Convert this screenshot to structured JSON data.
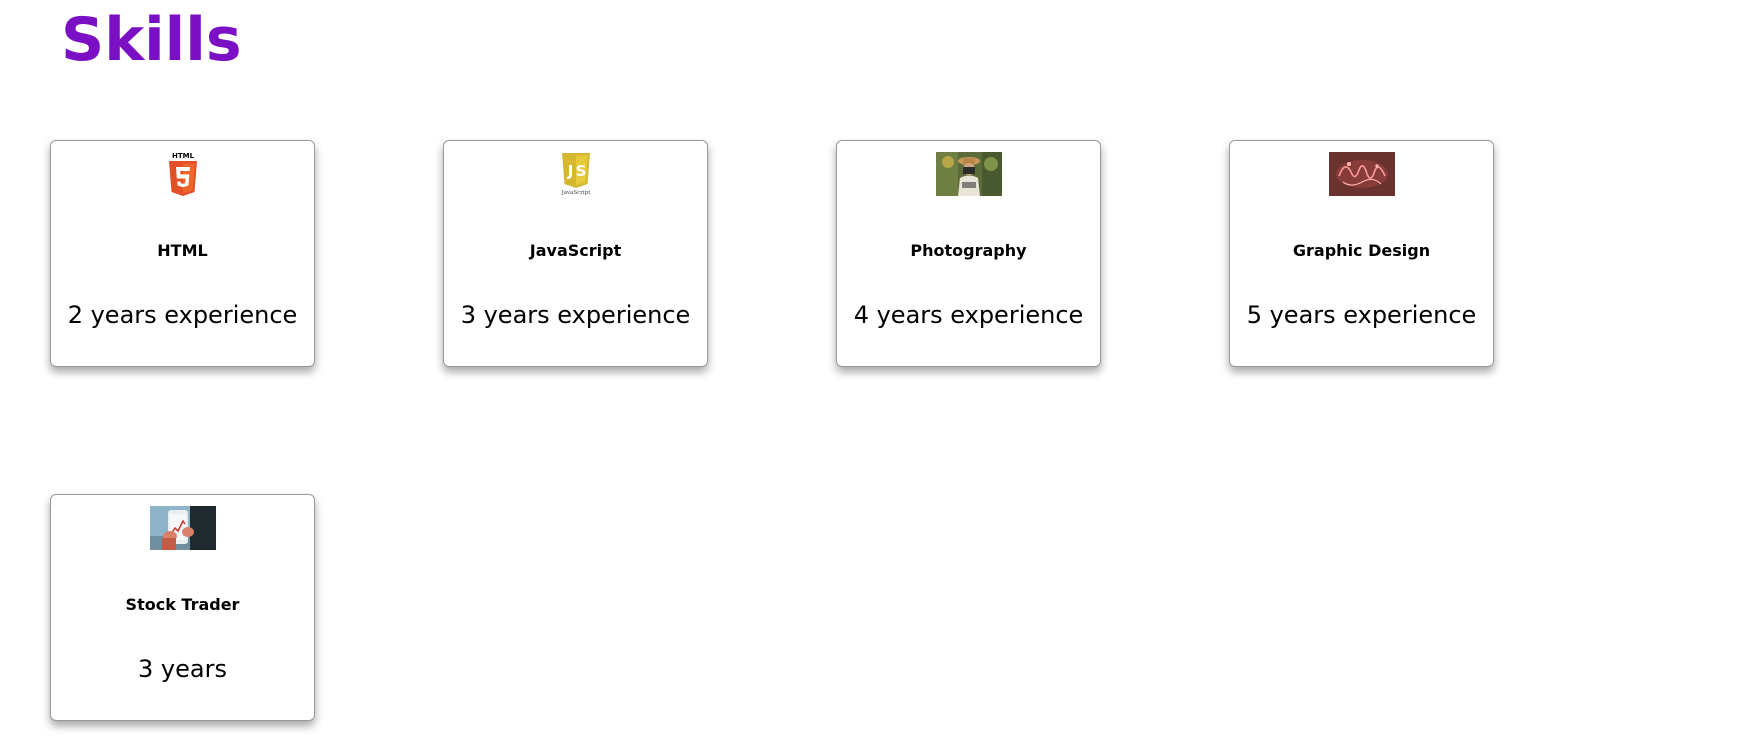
{
  "page": {
    "title": "Skills",
    "title_color": "#7a0fc4"
  },
  "skills": [
    {
      "name": "HTML",
      "experience": "2 years experience",
      "icon": "html5-logo-icon",
      "icon_text": "HTML"
    },
    {
      "name": "JavaScript",
      "experience": "3 years experience",
      "icon": "javascript-logo-icon",
      "icon_text": "JavaScript"
    },
    {
      "name": "Photography",
      "experience": "4 years experience",
      "icon": "photography-image"
    },
    {
      "name": "Graphic Design",
      "experience": "5 years experience",
      "icon": "neon-sign-image"
    },
    {
      "name": "Stock Trader",
      "experience": "3 years",
      "icon": "phone-trading-image"
    }
  ],
  "colors": {
    "html5_orange": "#e34f26",
    "js_yellow": "#d4b830",
    "card_border": "#9a9a9a"
  }
}
